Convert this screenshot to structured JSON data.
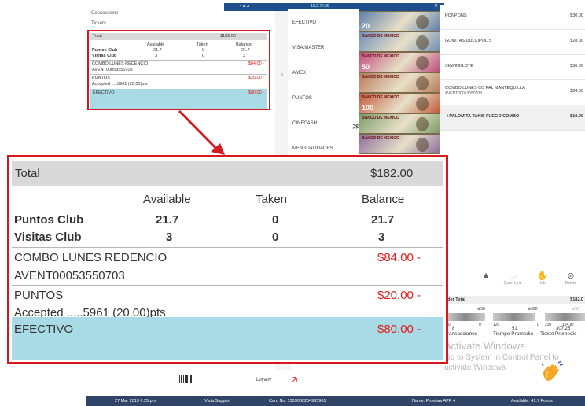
{
  "left_nav": {
    "concessions": "Concessions",
    "tickets": "Tickets"
  },
  "summary": {
    "total_label": "Total",
    "total_value": "$182.00",
    "columns": [
      "Available",
      "Taken",
      "Balance"
    ],
    "rows": [
      {
        "label": "Puntos Club",
        "available": "21.7",
        "taken": "0",
        "balance": "21.7"
      },
      {
        "label": "Visitas Club",
        "available": "3",
        "taken": "0",
        "balance": "3"
      }
    ],
    "combo": {
      "title": "COMBO LUNES REDENCIO",
      "code": "AVENT00053550703",
      "amount": "$84.00 -"
    },
    "puntos": {
      "title": "PUNTOS",
      "detail": "Accepted .....5961  (20.00)pts",
      "amount": "$20.00 -"
    },
    "efectivo": {
      "title": "EFECTIVO",
      "amount": "$80.00 -"
    }
  },
  "window": {
    "title_text": "10.2.70.29",
    "controls": "▾  ■  ⊿"
  },
  "payment_methods": [
    "EFECTIVO",
    "VISA/MASTER",
    "AMEX",
    "PUNTOS",
    "CINECASH",
    "MENSUALIDADES"
  ],
  "banknotes": [
    {
      "bank": "",
      "value": "20",
      "color": "#5d7fa8"
    },
    {
      "bank": "BANCO DE MEXICO",
      "value": "",
      "color": "#6f8fb6"
    },
    {
      "bank": "BANCO DE MEXICO",
      "value": "50",
      "color": "#c04d7e"
    },
    {
      "bank": "BANCO DE MEXICO",
      "value": "",
      "color": "#b97a5a"
    },
    {
      "bank": "BANCO DE MEXICO",
      "value": "100",
      "color": "#c25b3b"
    },
    {
      "bank": "BANCO DE MEXICO",
      "value": "",
      "color": "#7c9c6a"
    },
    {
      "bank": "BANCO DE MEXICO",
      "value": "",
      "color": "#8c6e9c"
    }
  ],
  "items": [
    {
      "name": "PONPONS",
      "sub": "",
      "price": "$30.00"
    },
    {
      "name": "GOMITAS DULCIPOLIS",
      "sub": "",
      "price": "$28.00"
    },
    {
      "name": "SKWINKLOTE",
      "sub": "",
      "price": "$30.00"
    },
    {
      "name": "COMBO LUNES CC PAL MANTEQUILLA",
      "sub": "AVENT00053550703",
      "price": "$84.00"
    },
    {
      "name": "+PALOMITA TAKIS FUEGO COMBO",
      "sub": "",
      "price": "$10.00"
    }
  ],
  "right_toolbar": {
    "open_label": "Open Line",
    "hold_label": "Hold",
    "delete_label": "Delete"
  },
  "order_total": {
    "label": "rder Total",
    "value": "$182.0"
  },
  "gauges": {
    "g1_top": "⊕50",
    "g2_top": "⊕320",
    "g2_top_b": "⊕50",
    "ticks_a": [
      "50",
      "0",
      "120"
    ],
    "ticks_b": [
      "0",
      "230",
      "124.87"
    ],
    "value_a": "8",
    "value_b": "51",
    "value_c": "307.25",
    "transacciones": "Transacciones",
    "tiempo": "Tiempo Promedio",
    "ticket": "Ticket Promedic"
  },
  "activation": {
    "line1": "Activate Windows",
    "line2": "Go to System in Control Panel to",
    "line3": "activate Windows."
  },
  "bottom_toolbar": {
    "loyalty": "Loyalty"
  },
  "status_bar": {
    "datetime": "27 Mar 2019 6:25 pm",
    "support": "Vista Support",
    "card": "Card No: 1303030234935961",
    "name": "Name: Pruebas APP 4",
    "available": "Available: 41.7 Points"
  },
  "colors": {
    "highlight_border": "#d7191f",
    "amount_red": "#e11b1b",
    "efectivo_bg": "#a9dbe6",
    "total_bg": "#d9d9d9",
    "status_bg": "#2f4466"
  }
}
